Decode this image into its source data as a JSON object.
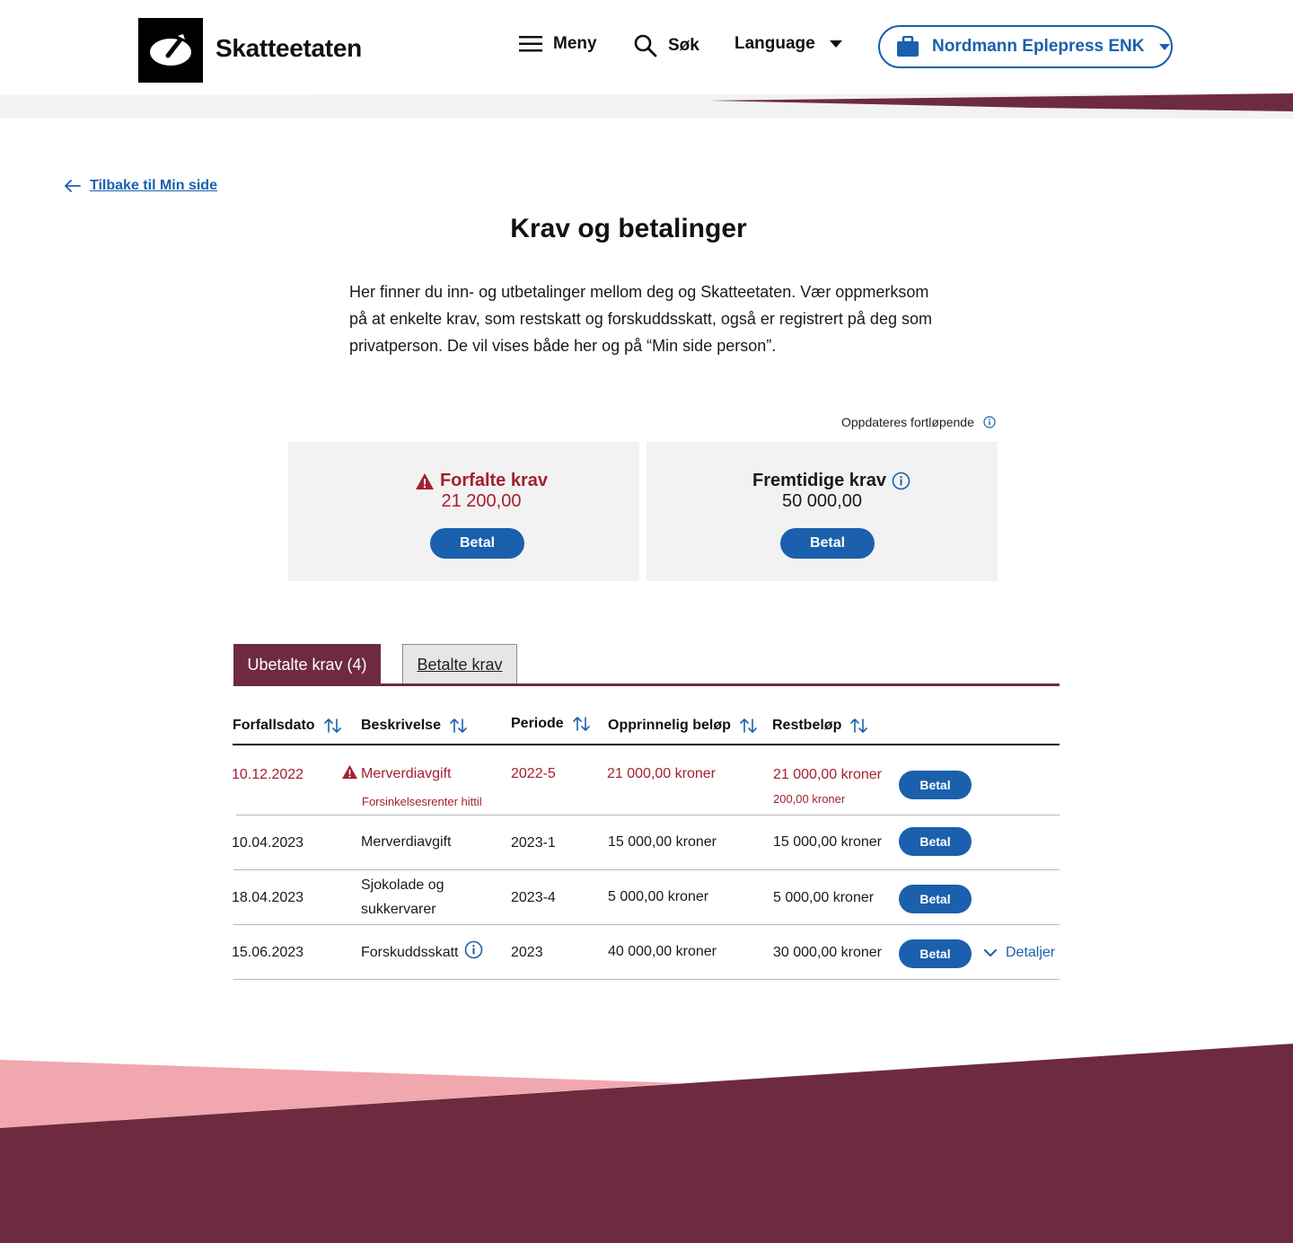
{
  "header": {
    "logo_text": "Skatteetaten",
    "nav": {
      "menu": "Meny",
      "search": "Søk",
      "language": "Language"
    },
    "org_name": "Nordmann Eplepress ENK"
  },
  "back_link": "Tilbake til Min side",
  "page_title": "Krav og betalinger",
  "intro": "Her finner du inn- og utbetalinger mellom deg og Skatteetaten. Vær oppmerksom på at enkelte krav, som restskatt og forskuddsskatt, også er registrert på deg som privatperson. De vil vises både her og på “Min side person”.",
  "update_note": "Oppdateres fortløpende",
  "cards": {
    "overdue": {
      "title": "Forfalte krav",
      "amount": "21 200,00",
      "button": "Betal"
    },
    "future": {
      "title": "Fremtidige krav",
      "amount": "50 000,00",
      "button": "Betal"
    }
  },
  "tabs": {
    "unpaid": "Ubetalte krav (4)",
    "paid": "Betalte krav"
  },
  "table": {
    "headers": {
      "due_date": "Forfallsdato",
      "description": "Beskrivelse",
      "period": "Periode",
      "original": "Opprinnelig beløp",
      "remaining": "Restbeløp"
    },
    "rows": [
      {
        "due_date": "10.12.2022",
        "description": "Merverdiavgift",
        "sub_description": "Forsinkelsesrenter hittil",
        "period": "2022-5",
        "original": "21 000,00 kroner",
        "remaining": "21 000,00 kroner",
        "sub_remaining": "200,00 kroner",
        "button": "Betal"
      },
      {
        "due_date": "10.04.2023",
        "description": "Merverdiavgift",
        "period": "2023-1",
        "original": "15 000,00 kroner",
        "remaining": "15 000,00 kroner",
        "button": "Betal"
      },
      {
        "due_date": "18.04.2023",
        "description_line1": "Sjokolade og",
        "description_line2": "sukkervarer",
        "period": "2023-4",
        "original": "5 000,00 kroner",
        "remaining": "5 000,00 kroner",
        "button": "Betal"
      },
      {
        "due_date": "15.06.2023",
        "description": "Forskuddsskatt",
        "period": "2023",
        "original": "40 000,00 kroner",
        "remaining": "30 000,00 kroner",
        "button": "Betal",
        "details": "Detaljer"
      }
    ]
  },
  "colors": {
    "brand_blue": "#1a60ad",
    "burgundy": "#6e2b3f",
    "alert_red": "#a4202f",
    "pink": "#f0a7ad"
  },
  "icons": [
    "menu-icon",
    "search-icon",
    "caret-down-icon",
    "briefcase-icon",
    "arrow-left-icon",
    "info-icon",
    "warning-icon",
    "sort-icon",
    "chevron-down-icon"
  ]
}
